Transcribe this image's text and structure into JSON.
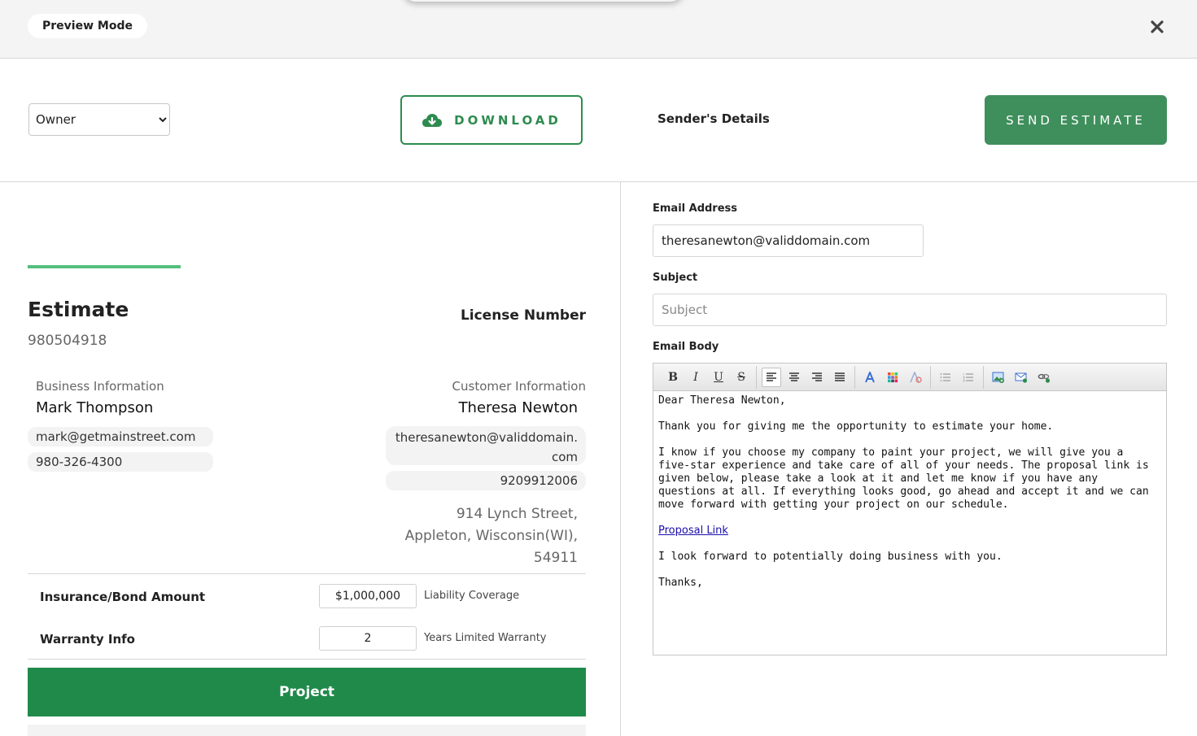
{
  "header": {
    "preview_label": "Preview Mode",
    "close_icon": "close-icon"
  },
  "actions": {
    "role_selected": "Owner",
    "download_label": "DOWNLOAD",
    "download_icon": "cloud-download-icon",
    "senders_details": "Sender's Details",
    "send_label": "SEND ESTIMATE",
    "accent_color": "#2e8b4f"
  },
  "estimate": {
    "title": "Estimate",
    "number": "980504918",
    "license_label": "License Number"
  },
  "business": {
    "label": "Business Information",
    "name": "Mark Thompson",
    "email": "mark@getmainstreet.com",
    "phone": "980-326-4300"
  },
  "customer": {
    "label": "Customer Information",
    "name": "Theresa Newton",
    "email": "theresanewton@validdomain.com",
    "phone": "9209912006",
    "address_line1": "914 Lynch Street,",
    "address_line2": "Appleton, Wisconsin(WI),",
    "address_line3": "54911"
  },
  "terms": {
    "insurance_label": "Insurance/Bond Amount",
    "insurance_value": "$1,000,000",
    "insurance_suffix": "Liability Coverage",
    "warranty_label": "Warranty Info",
    "warranty_value": "2",
    "warranty_suffix": "Years Limited Warranty"
  },
  "project": {
    "label": "Project",
    "color": "#1f8a4a"
  },
  "email": {
    "address_label": "Email Address",
    "address_value": "theresanewton@validdomain.com",
    "subject_label": "Subject",
    "subject_placeholder": "Subject",
    "body_label": "Email Body",
    "body": {
      "greeting": "Dear Theresa Newton,",
      "p1": "Thank you for giving me the opportunity to estimate your home.",
      "p2": "I know if you choose my company to paint your project, we will give you a five-star experience and take care of all of your needs. The proposal link is given below, please take a look at it and let me know if you have any questions at all. If everything looks good, go ahead and accept it and we can move forward with getting your project on our schedule.",
      "link": "Proposal Link",
      "p3": "I look forward to potentially doing business with you.",
      "closing": "Thanks,"
    }
  },
  "toolbar": {
    "bold": "B",
    "italic": "I",
    "underline": "U",
    "strike": "S"
  }
}
